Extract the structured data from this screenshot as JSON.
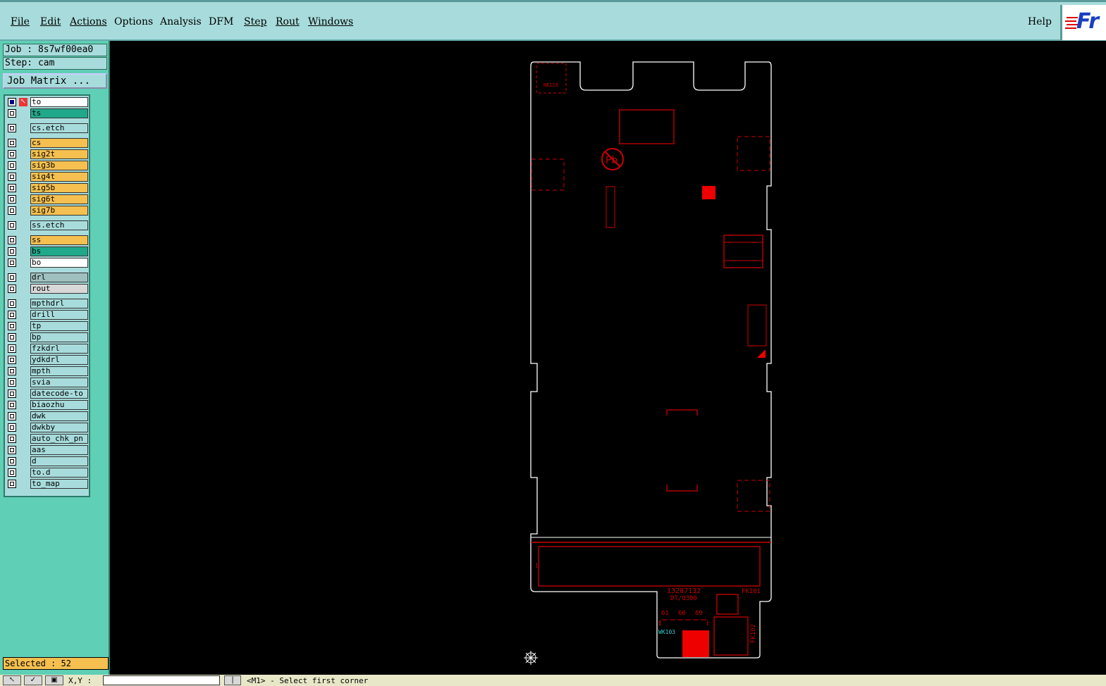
{
  "menu": {
    "items": [
      {
        "label": "File",
        "name": "menu-file"
      },
      {
        "label": "Edit",
        "name": "menu-edit"
      },
      {
        "label": "Actions",
        "name": "menu-actions"
      },
      {
        "label": "Options",
        "name": "menu-options"
      },
      {
        "label": "Analysis",
        "name": "menu-analysis"
      },
      {
        "label": "DFM",
        "name": "menu-dfm"
      },
      {
        "label": "Step",
        "name": "menu-step"
      },
      {
        "label": "Rout",
        "name": "menu-rout"
      },
      {
        "label": "Windows",
        "name": "menu-windows"
      }
    ],
    "help": "Help"
  },
  "logo": "Fr",
  "job": {
    "label": "Job : 8s7wf00ea0",
    "step": "Step: cam",
    "matrix_button": "Job Matrix ..."
  },
  "layers": [
    {
      "name": "to",
      "color": "#ffffff",
      "active": true
    },
    {
      "name": "ts",
      "color": "#1fa88a"
    },
    {
      "name": "cs.etch",
      "color": "#a8dcdc"
    },
    {
      "name": "cs",
      "color": "#f5c050"
    },
    {
      "name": "sig2t",
      "color": "#f5c050"
    },
    {
      "name": "sig3b",
      "color": "#f5c050"
    },
    {
      "name": "sig4t",
      "color": "#f5c050"
    },
    {
      "name": "sig5b",
      "color": "#f5c050"
    },
    {
      "name": "sig6t",
      "color": "#f5c050"
    },
    {
      "name": "sig7b",
      "color": "#f5c050"
    },
    {
      "name": "ss.etch",
      "color": "#a8dcdc"
    },
    {
      "name": "ss",
      "color": "#f5c050"
    },
    {
      "name": "bs",
      "color": "#1fa88a"
    },
    {
      "name": "bo",
      "color": "#ffffff"
    },
    {
      "name": "drl",
      "color": "#a0c0c0"
    },
    {
      "name": "rout",
      "color": "#d8d8d8"
    },
    {
      "name": "mpthdrl",
      "color": "#a8dcdc"
    },
    {
      "name": "drill",
      "color": "#a8dcdc"
    },
    {
      "name": "tp",
      "color": "#a8dcdc"
    },
    {
      "name": "bp",
      "color": "#a8dcdc"
    },
    {
      "name": "fzkdrl",
      "color": "#a8dcdc"
    },
    {
      "name": "ydkdrl",
      "color": "#a8dcdc"
    },
    {
      "name": "mpth",
      "color": "#a8dcdc"
    },
    {
      "name": "svia",
      "color": "#a8dcdc"
    },
    {
      "name": "datecode-to",
      "color": "#a8dcdc"
    },
    {
      "name": "biaozhu",
      "color": "#a8dcdc"
    },
    {
      "name": "dwk",
      "color": "#a8dcdc"
    },
    {
      "name": "dwkby",
      "color": "#a8dcdc"
    },
    {
      "name": "auto_chk_pn",
      "color": "#a8dcdc"
    },
    {
      "name": "aas",
      "color": "#a8dcdc"
    },
    {
      "name": "d",
      "color": "#a8dcdc"
    },
    {
      "name": "to.d",
      "color": "#a8dcdc"
    },
    {
      "name": "to_map",
      "color": "#a8dcdc"
    }
  ],
  "selected": "Selected : 52",
  "board_labels": {
    "top_left": "NE116",
    "pn": "13207132",
    "dt": "DT/O300",
    "fk101": "FK101",
    "fk102": "FK102",
    "wk103": "WK103",
    "n61": "61",
    "n66": "66",
    "n69": "69",
    "n1": "1",
    "n1b": "1"
  },
  "bottom": {
    "xy_label": "X,Y :",
    "status": "<M1> - Select first corner"
  }
}
